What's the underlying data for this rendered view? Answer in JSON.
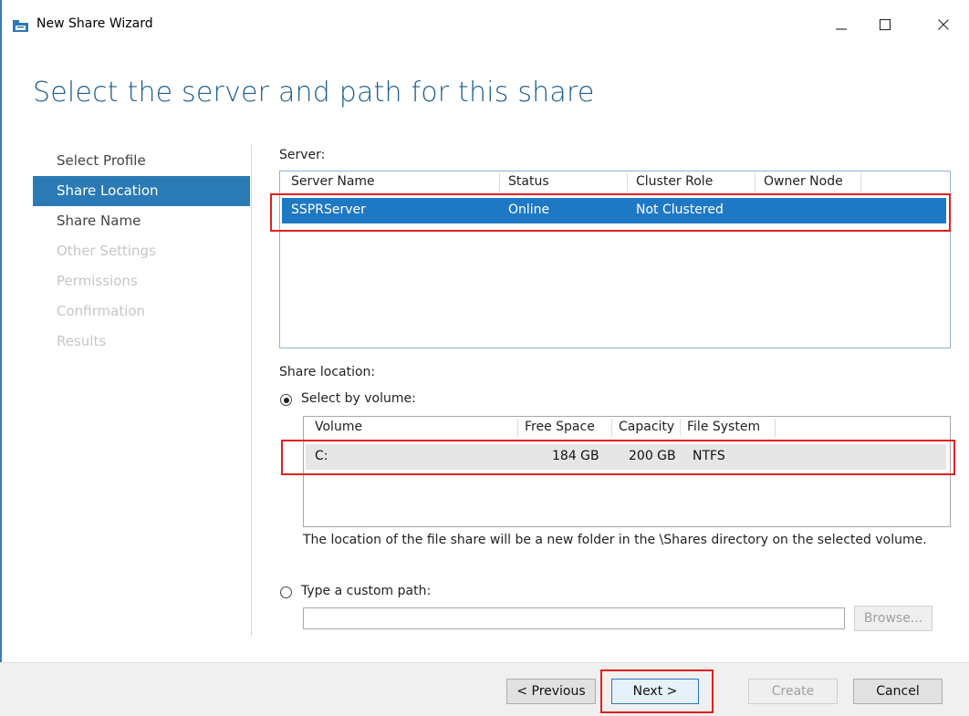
{
  "window": {
    "title": "New Share Wizard",
    "icon": "share-wizard-icon"
  },
  "page_title": "Select the server and path for this share",
  "nav": {
    "items": [
      {
        "label": "Select Profile",
        "state": "normal"
      },
      {
        "label": "Share Location",
        "state": "active"
      },
      {
        "label": "Share Name",
        "state": "normal"
      },
      {
        "label": "Other Settings",
        "state": "disabled"
      },
      {
        "label": "Permissions",
        "state": "disabled"
      },
      {
        "label": "Confirmation",
        "state": "disabled"
      },
      {
        "label": "Results",
        "state": "disabled"
      }
    ]
  },
  "server": {
    "label": "Server:",
    "columns": [
      "Server Name",
      "Status",
      "Cluster Role",
      "Owner Node"
    ],
    "rows": [
      {
        "server_name": "SSPRServer",
        "status": "Online",
        "cluster_role": "Not Clustered",
        "owner_node": ""
      }
    ]
  },
  "share_location": {
    "label": "Share location:",
    "by_volume_label": "Select by volume:",
    "by_volume_selected": true,
    "volume_columns": [
      "Volume",
      "Free Space",
      "Capacity",
      "File System"
    ],
    "volumes": [
      {
        "volume": "C:",
        "free_space": "184 GB",
        "capacity": "200 GB",
        "file_system": "NTFS"
      }
    ],
    "note": "The location of the file share will be a new folder in the \\Shares directory on the selected volume.",
    "custom_path_label": "Type a custom path:",
    "custom_path_selected": false,
    "custom_path_value": "",
    "browse_label": "Browse..."
  },
  "buttons": {
    "previous": "< Previous",
    "next": "Next >",
    "create": "Create",
    "cancel": "Cancel"
  },
  "colors": {
    "accent": "#2a7ab5",
    "title": "#1f5f8f",
    "highlight": "#e02020"
  }
}
